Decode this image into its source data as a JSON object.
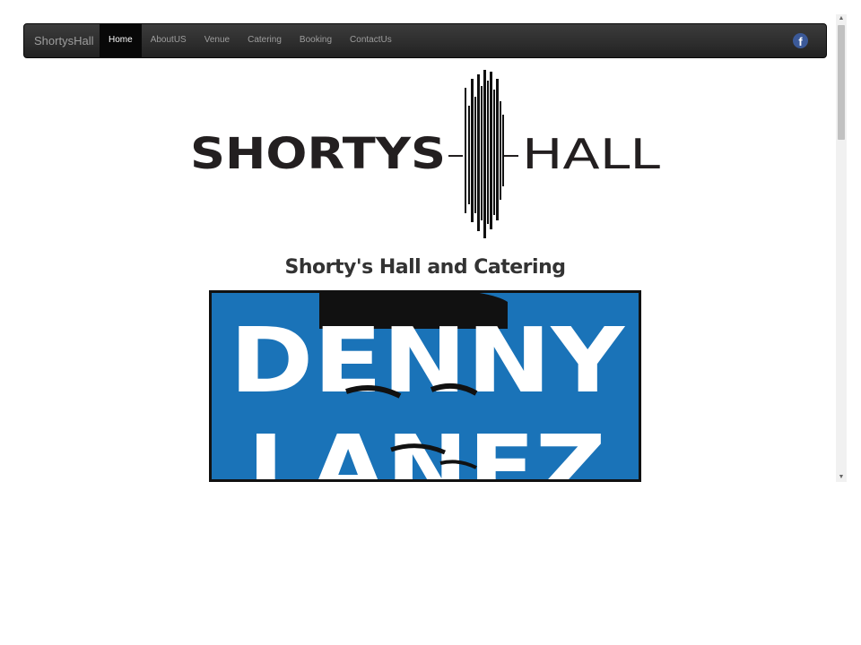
{
  "navbar": {
    "brand": "ShortysHall",
    "items": [
      {
        "label": "Home",
        "active": true
      },
      {
        "label": "AboutUS",
        "active": false
      },
      {
        "label": "Venue",
        "active": false
      },
      {
        "label": "Catering",
        "active": false
      },
      {
        "label": "Booking",
        "active": false
      },
      {
        "label": "ContactUs",
        "active": false
      }
    ],
    "social_icon": "facebook-icon",
    "facebook_glyph": "f"
  },
  "logo": {
    "left_text": "SHORTYS",
    "right_text": "HALL"
  },
  "main": {
    "heading": "Shorty's Hall and Catering",
    "poster": {
      "line1": "DENNY",
      "line2": "LANEZ",
      "background_color": "#1a73b8"
    }
  },
  "scrollbar": {
    "up_arrow": "▲",
    "down_arrow": "▼"
  }
}
